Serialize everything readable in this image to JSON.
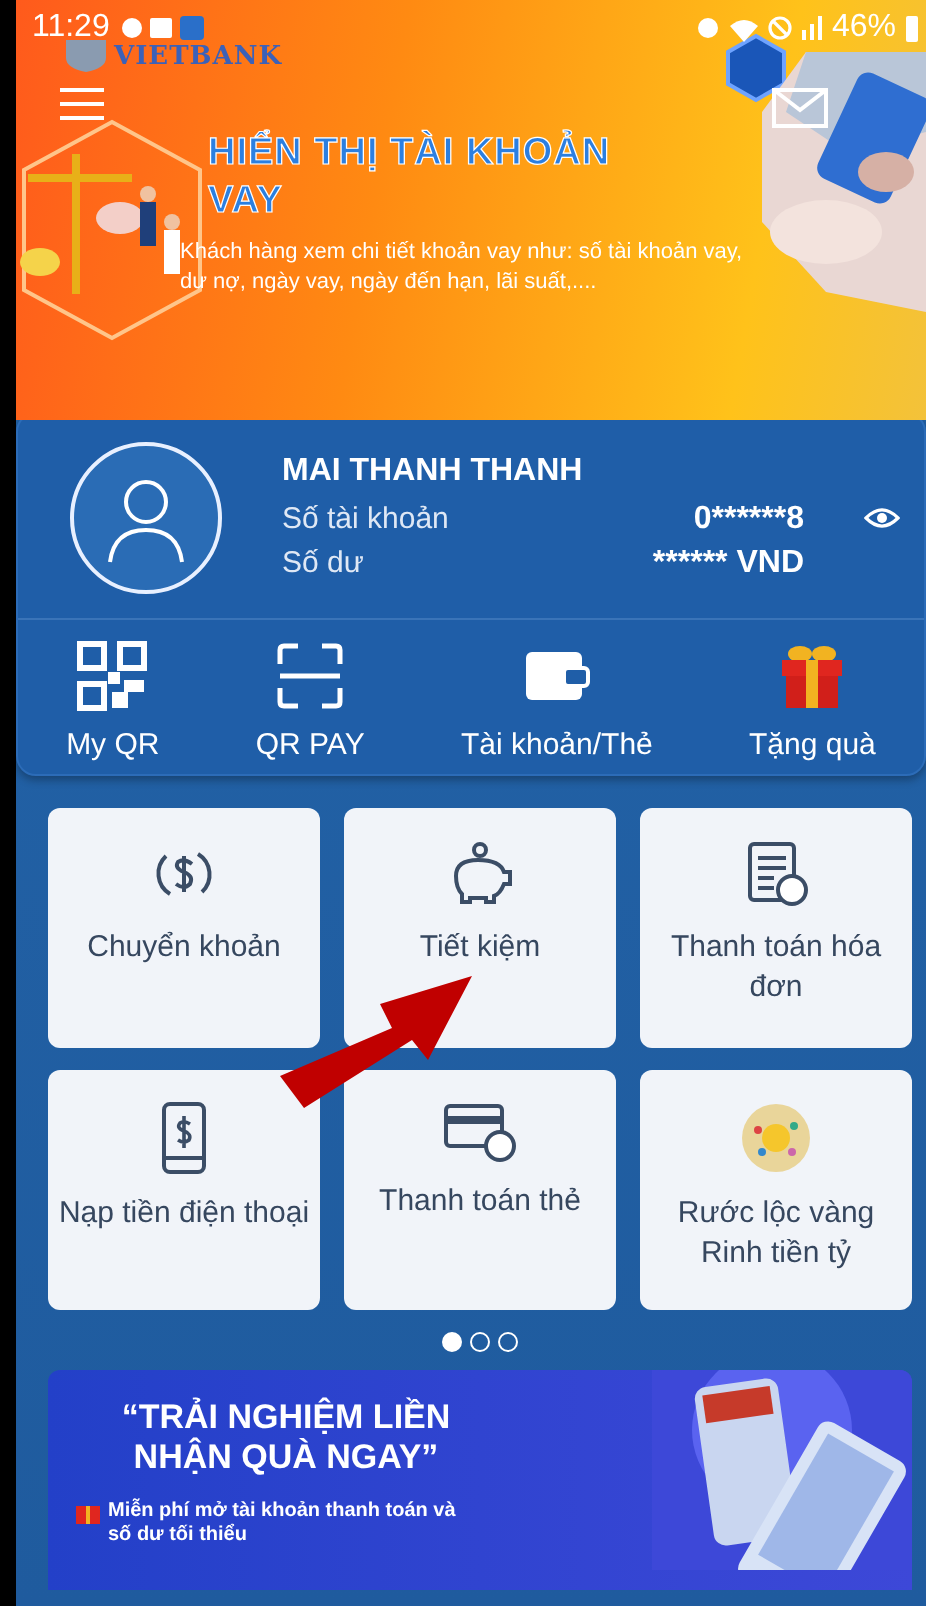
{
  "status_bar": {
    "time": "11:29",
    "battery": "46%"
  },
  "header": {
    "logo": "VIETBANK"
  },
  "banner": {
    "title": "HIỂN THỊ TÀI KHOẢN VAY",
    "description": "Khách hàng xem chi tiết khoản vay như: số tài khoản vay, dư nợ, ngày vay, ngày đến hạn, lãi suất,...."
  },
  "account": {
    "name": "MAI THANH THANH",
    "account_label": "Số tài khoản",
    "account_number": "0******8",
    "balance_label": "Số dư",
    "balance": "****** VND"
  },
  "quick_actions": [
    {
      "kind": "qr",
      "label": "My QR"
    },
    {
      "kind": "scan",
      "label": "QR PAY"
    },
    {
      "kind": "wallet",
      "label": "Tài khoản/Thẻ"
    },
    {
      "kind": "gift",
      "label": "Tặng quà"
    }
  ],
  "services": [
    {
      "kind": "transfer",
      "label": "Chuyển khoản"
    },
    {
      "kind": "savings",
      "label": "Tiết kiệm"
    },
    {
      "kind": "bill",
      "label": "Thanh toán hóa đơn"
    },
    {
      "kind": "topup",
      "label": "Nạp tiền điện thoại"
    },
    {
      "kind": "card",
      "label": "Thanh toán thẻ"
    },
    {
      "kind": "lucky",
      "label": "Rước lộc vàng Rinh tiền tỷ"
    }
  ],
  "pager": [
    {
      "selected": true
    },
    {
      "selected": false
    },
    {
      "selected": false
    }
  ],
  "promo": {
    "headline": "“TRẢI NGHIỆM LIỀN NHẬN QUÀ NGAY”",
    "offer": "Miễn phí mở tài khoản thanh toán và",
    "offer_cont": "số dư tối thiểu"
  }
}
